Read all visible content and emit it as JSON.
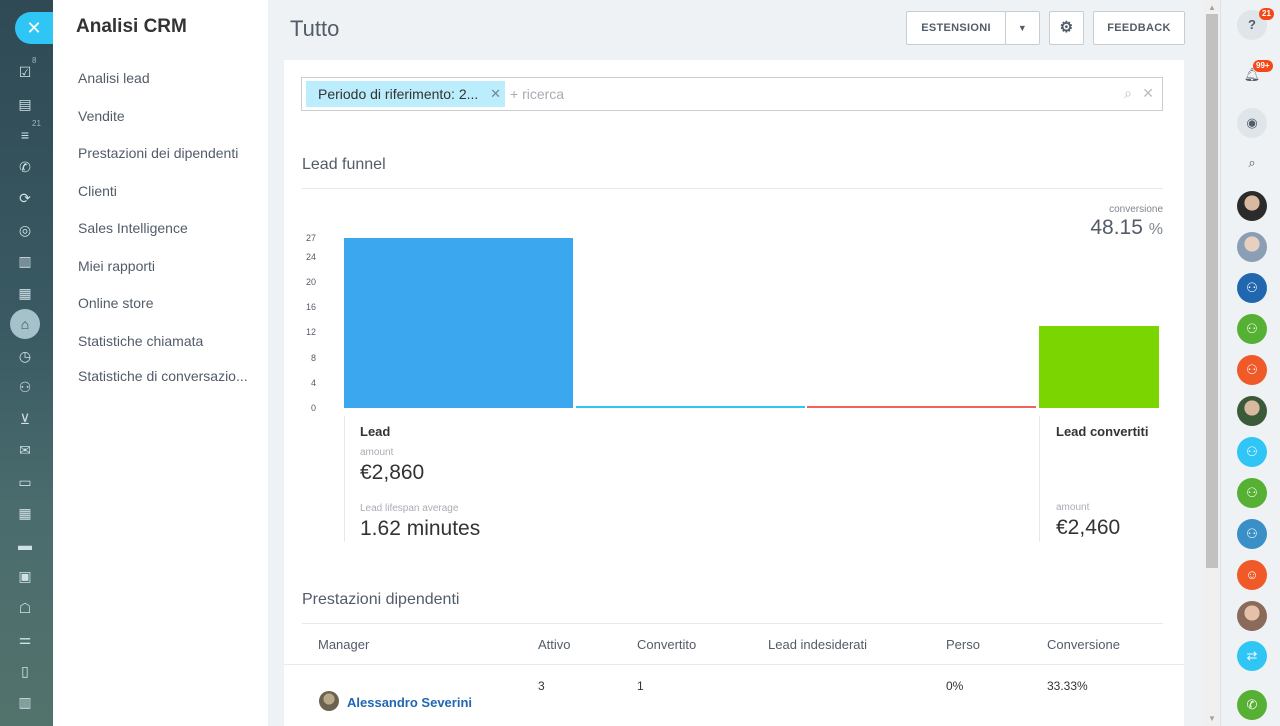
{
  "left_rail": {
    "close_icon": "close-icon",
    "icons": [
      {
        "name": "tasks-icon",
        "glyph": "☑",
        "badge": "8"
      },
      {
        "name": "feed-icon",
        "glyph": "▤",
        "badge": ""
      },
      {
        "name": "filter-icon",
        "glyph": "≡",
        "badge": "21"
      },
      {
        "name": "phone-icon",
        "glyph": "✆",
        "badge": ""
      },
      {
        "name": "sync-icon",
        "glyph": "⟳",
        "badge": ""
      },
      {
        "name": "target-icon",
        "glyph": "◎",
        "badge": ""
      },
      {
        "name": "analytics-icon",
        "glyph": "▥",
        "badge": ""
      },
      {
        "name": "grid-icon",
        "glyph": "▦",
        "badge": ""
      },
      {
        "name": "crm-icon",
        "glyph": "⌂",
        "badge": ""
      },
      {
        "name": "clock-icon",
        "glyph": "◷",
        "badge": ""
      },
      {
        "name": "users-icon",
        "glyph": "⚇",
        "badge": ""
      },
      {
        "name": "cart-icon",
        "glyph": "⊻",
        "badge": ""
      },
      {
        "name": "mail-icon",
        "glyph": "✉",
        "badge": ""
      },
      {
        "name": "window-icon",
        "glyph": "▭",
        "badge": ""
      },
      {
        "name": "calendar-icon",
        "glyph": "▦",
        "badge": ""
      },
      {
        "name": "drive-icon",
        "glyph": "▬",
        "badge": ""
      },
      {
        "name": "contact-card-icon",
        "glyph": "▣",
        "badge": ""
      },
      {
        "name": "robot-icon",
        "glyph": "☖",
        "badge": ""
      },
      {
        "name": "settings-sliders-icon",
        "glyph": "⚌",
        "badge": ""
      },
      {
        "name": "document-icon",
        "glyph": "▯",
        "badge": ""
      },
      {
        "name": "book-icon",
        "glyph": "▥",
        "badge": ""
      }
    ]
  },
  "submenu": {
    "title": "Analisi CRM",
    "items": [
      "Analisi lead",
      "Vendite",
      "Prestazioni dei dipendenti",
      "Clienti",
      "Sales Intelligence",
      "Miei rapporti",
      "Online store",
      "Statistiche chiamata",
      "Statistiche di conversazio..."
    ]
  },
  "header": {
    "title": "Tutto",
    "extensions_label": "ESTENSIONI",
    "feedback_label": "FEEDBACK"
  },
  "filter": {
    "chip_label": "Periodo di riferimento: 2...",
    "placeholder": "+ ricerca"
  },
  "funnel": {
    "title": "Lead funnel",
    "conversion_label": "conversione",
    "conversion_value": "48.15",
    "conversion_unit": "%",
    "lead": {
      "name": "Lead",
      "amount_label": "amount",
      "amount": "€2,860",
      "lifespan_label": "Lead lifespan average",
      "lifespan": "1.62 minutes"
    },
    "converted": {
      "name": "Lead convertiti",
      "amount_label": "amount",
      "amount": "€2,460"
    }
  },
  "chart_data": {
    "type": "bar",
    "categories": [
      "Lead",
      "",
      "",
      "Lead convertiti"
    ],
    "values": [
      27,
      0,
      0,
      13
    ],
    "colors": [
      "#3ba7ef",
      "#2fc6f6",
      "#f0635a",
      "#7bd500"
    ],
    "yticks": [
      "27",
      "24",
      "20",
      "16",
      "12",
      "8",
      "4",
      "0"
    ],
    "ylim": [
      0,
      27
    ]
  },
  "performance": {
    "title": "Prestazioni dipendenti",
    "columns": [
      "Manager",
      "Attivo",
      "Convertito",
      "Lead indesiderati",
      "Perso",
      "Conversione"
    ],
    "rows": [
      {
        "manager": "Alessandro Severini",
        "attivo": "3",
        "convertito": "1",
        "indesiderati": "",
        "perso": "0%",
        "conversione": "33.33%"
      }
    ]
  },
  "right_panel": {
    "help_badge": "21",
    "notifications_badge": "99+"
  }
}
